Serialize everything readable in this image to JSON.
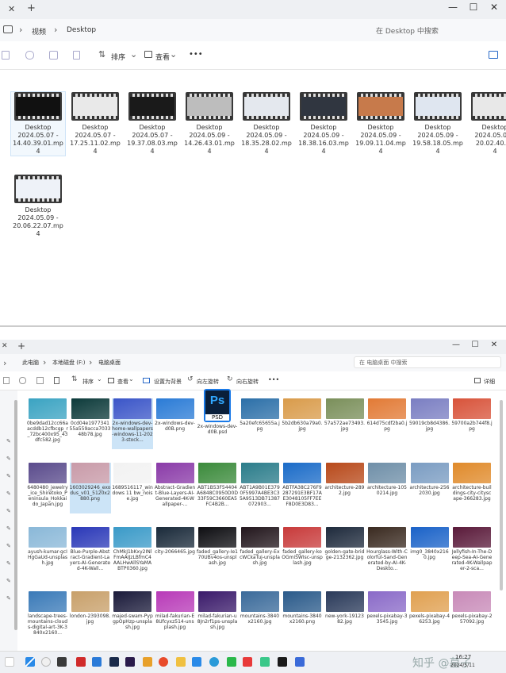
{
  "win1": {
    "tab_add": "+",
    "min": "—",
    "max": "☐",
    "close": "✕",
    "crumbs": [
      "视频",
      "Desktop"
    ],
    "search_placeholder": "在 Desktop 中搜索",
    "toolbar": {
      "sort": "排序",
      "view": "查看",
      "more": "•••"
    },
    "videos": [
      {
        "name": "Desktop",
        "date": "2024.05.07 -",
        "time": "14.40.39.01.mp",
        "ext": "4",
        "tone": "#111"
      },
      {
        "name": "Desktop",
        "date": "2024.05.07 -",
        "time": "17.25.11.02.mp",
        "ext": "4",
        "tone": "#e9e9e9"
      },
      {
        "name": "Desktop",
        "date": "2024.05.07 -",
        "time": "19.37.08.03.mp",
        "ext": "4",
        "tone": "#1a1a1a"
      },
      {
        "name": "Desktop",
        "date": "2024.05.09 -",
        "time": "14.26.43.01.mp",
        "ext": "4",
        "tone": "#bdbdbd"
      },
      {
        "name": "Desktop",
        "date": "2024.05.09 -",
        "time": "18.35.28.02.mp",
        "ext": "4",
        "tone": "#e4e8ee"
      },
      {
        "name": "Desktop",
        "date": "2024.05.09 -",
        "time": "18.38.16.03.mp",
        "ext": "4",
        "tone": "#303640"
      },
      {
        "name": "Desktop",
        "date": "2024.05.09 -",
        "time": "19.09.11.04.mp",
        "ext": "4",
        "tone": "#c77a4b"
      },
      {
        "name": "Desktop",
        "date": "2024.05.09 -",
        "time": "19.58.18.05.mp",
        "ext": "4",
        "tone": "#dfe6f0"
      },
      {
        "name": "Desktop",
        "date": "2024.05.09 -",
        "time": "20.02.40.06",
        "ext": "4",
        "tone": "#e8e8e8"
      },
      {
        "name": "Desktop",
        "date": "2024.05.09 -",
        "time": "20.06.22.07.mp",
        "ext": "4",
        "tone": "#eef2f8"
      }
    ]
  },
  "win2": {
    "tab_add": "+",
    "min": "—",
    "max": "☐",
    "close": "✕",
    "crumbs": [
      "此电脑",
      "本地磁盘 (F:)",
      "电脑桌面"
    ],
    "search_placeholder": "在 电脑桌面 中搜索",
    "toolbar": {
      "sort": "排序",
      "view": "查看",
      "set_bg": "设置为背景",
      "rotate_left": "向左旋转",
      "rotate_right": "向右旋转",
      "more": "•••",
      "details": "详细"
    },
    "psd_badge": "Ps",
    "psd_text": "PSD",
    "images": [
      {
        "label": "0be9dad12cc66aacddb12cfbcgp_r_72bc400x95_43dfc582.jpg",
        "c": "#3aa3c2",
        "sel": false
      },
      {
        "label": "0cd04e197734155a559acca703348b78.jpg",
        "c": "#0c3a3a",
        "sel": false
      },
      {
        "label": "2x-windows-dev-home-wallpapers-windows-11-2023-stock...",
        "c": "#3a55c8",
        "sel": true
      },
      {
        "label": "2x-windows-dev-d0B.png",
        "c": "#2a7bd6",
        "sel": false
      },
      {
        "label": "2x-windows-dev-d0B.psd",
        "c": "psd",
        "sel": false
      },
      {
        "label": "5a20efc65655a.jpg",
        "c": "#2b6fa8",
        "sel": false
      },
      {
        "label": "5b2db630a79a0.jpg",
        "c": "#d99b4a",
        "sel": false
      },
      {
        "label": "57a572ae73493.jpg",
        "c": "#7a8f5a",
        "sel": false
      },
      {
        "label": "614d75cdf2ba0.jpg",
        "c": "#e27a35",
        "sel": false
      },
      {
        "label": "59019cb8d4386.jpg",
        "c": "#7a7ec2",
        "sel": false
      },
      {
        "label": "59700a2b744f8.jpg",
        "c": "#d8533a",
        "sel": false
      },
      {
        "label": "6480480_jewelry_ice_Shiretoko_Peninsula_Hokkaido_Japan.jpg",
        "c": "#5a4b8c",
        "sel": false
      },
      {
        "label": "1603029246_exodus_v01_5120x2880.png",
        "c": "#c89aa8",
        "sel": true
      },
      {
        "label": "1689516117_windows 11 bw_noise.jpg",
        "c": "#f2f2f2",
        "sel": false
      },
      {
        "label": "Abstract-Gradient-Blue-Layers-AI-Generated-4K-Wallpaper-...",
        "c": "#8a3aa8",
        "sel": false
      },
      {
        "label": "ABT1B53F54404A6848C0950D0D33F59C3660EA5FC4B2B...",
        "c": "#3a8a3a",
        "sel": false
      },
      {
        "label": "ABT1A9B01E3790F5997A4BE3C35A9513DB71387072903...",
        "c": "#2a7c8a",
        "sel": false
      },
      {
        "label": "ABTFA38C276F9287291E3BF17AE3048105FF7EEF8D0E3D83...",
        "c": "#1a6bc8",
        "sel": false
      },
      {
        "label": "architecture-2892.jpg",
        "c": "#b8491a",
        "sel": false
      },
      {
        "label": "architecture-1050214.jpg",
        "c": "#6f8fa8",
        "sel": false
      },
      {
        "label": "architecture-2562030.jpg",
        "c": "#7a9cc2",
        "sel": false
      },
      {
        "label": "architecture-buildings-city-cityscape-366283.jpg",
        "c": "#e08a2a",
        "sel": false
      },
      {
        "label": "ayush-kumar-gcIHgGaUd-unsplash.jpg",
        "c": "#8ab8d8",
        "sel": false
      },
      {
        "label": "Blue-Purple-Abstract-Gradient-Layers-AI-Generated-4K-Wall...",
        "c": "#2a38b8",
        "sel": false
      },
      {
        "label": "ChMkJ1bKxy2INlFmAAIJzLBfmC4AALHwAllSYaMABTP0360.jpg",
        "c": "#3a9ac8",
        "sel": false
      },
      {
        "label": "city-2066465.jpg",
        "c": "#1a2a3a",
        "sel": false
      },
      {
        "label": "faded_gallery-Ie170UBv4os-unsplash.jpg",
        "c": "#0e0e12",
        "sel": false
      },
      {
        "label": "faded_gallery-ExcWCkaTuj-unsplash.jpg",
        "c": "#22161c",
        "sel": false
      },
      {
        "label": "faded_gallery-koOGmiSWIsc-unsplash.jpg",
        "c": "#c83a3a",
        "sel": false
      },
      {
        "label": "golden-gate-bridge-2132362.jpg",
        "c": "#1e2a3c",
        "sel": false
      },
      {
        "label": "Hourglass-With-Colorful-Sand-Generated-by-AI-4K-Deskto...",
        "c": "#3a2a20",
        "sel": false
      },
      {
        "label": "img0_3840x2160.jpg",
        "c": "#1a62c8",
        "sel": false
      },
      {
        "label": "Jellyfish-In-The-Deep-Sea-AI-Generated-4K-Wallpaper-2-sca...",
        "c": "#5a1a3a",
        "sel": false
      },
      {
        "label": "landscape-trees-mountains-clouds-digital-art-3K-3840x2160...",
        "c": "#3a7ab8",
        "sel": false
      },
      {
        "label": "london-2393098.jpg",
        "c": "#c8a06a",
        "sel": false
      },
      {
        "label": "majed-swam-PypgpOpHzp-unsplash.jpg",
        "c": "#1a1a3a",
        "sel": false
      },
      {
        "label": "milad-fakurian-E8Ufcyxz514-unsplash.jpg",
        "c": "#b83ab8",
        "sel": false
      },
      {
        "label": "milad-fakurian-u8Jn2rf1ps-unsplash.jpg",
        "c": "#3a1a6a",
        "sel": false
      },
      {
        "label": "mountains-3840x2160.jpg",
        "c": "#3a6a9a",
        "sel": false
      },
      {
        "label": "mountains-3840x2160.png",
        "c": "#2a5a8a",
        "sel": false
      },
      {
        "label": "new-york-1912382.jpg",
        "c": "#2a3a5a",
        "sel": false
      },
      {
        "label": "pexels-pixabay-33545.jpg",
        "c": "#8a6ac8",
        "sel": false
      },
      {
        "label": "pexels-pixabay-46253.jpg",
        "c": "#e0a050",
        "sel": false
      },
      {
        "label": "pexels-pixabay-257092.jpg",
        "c": "#c88ab8",
        "sel": false
      }
    ]
  },
  "taskbar": {
    "time": "16:27",
    "date": "2024/5/11",
    "watermark": "知乎 @墓子"
  }
}
